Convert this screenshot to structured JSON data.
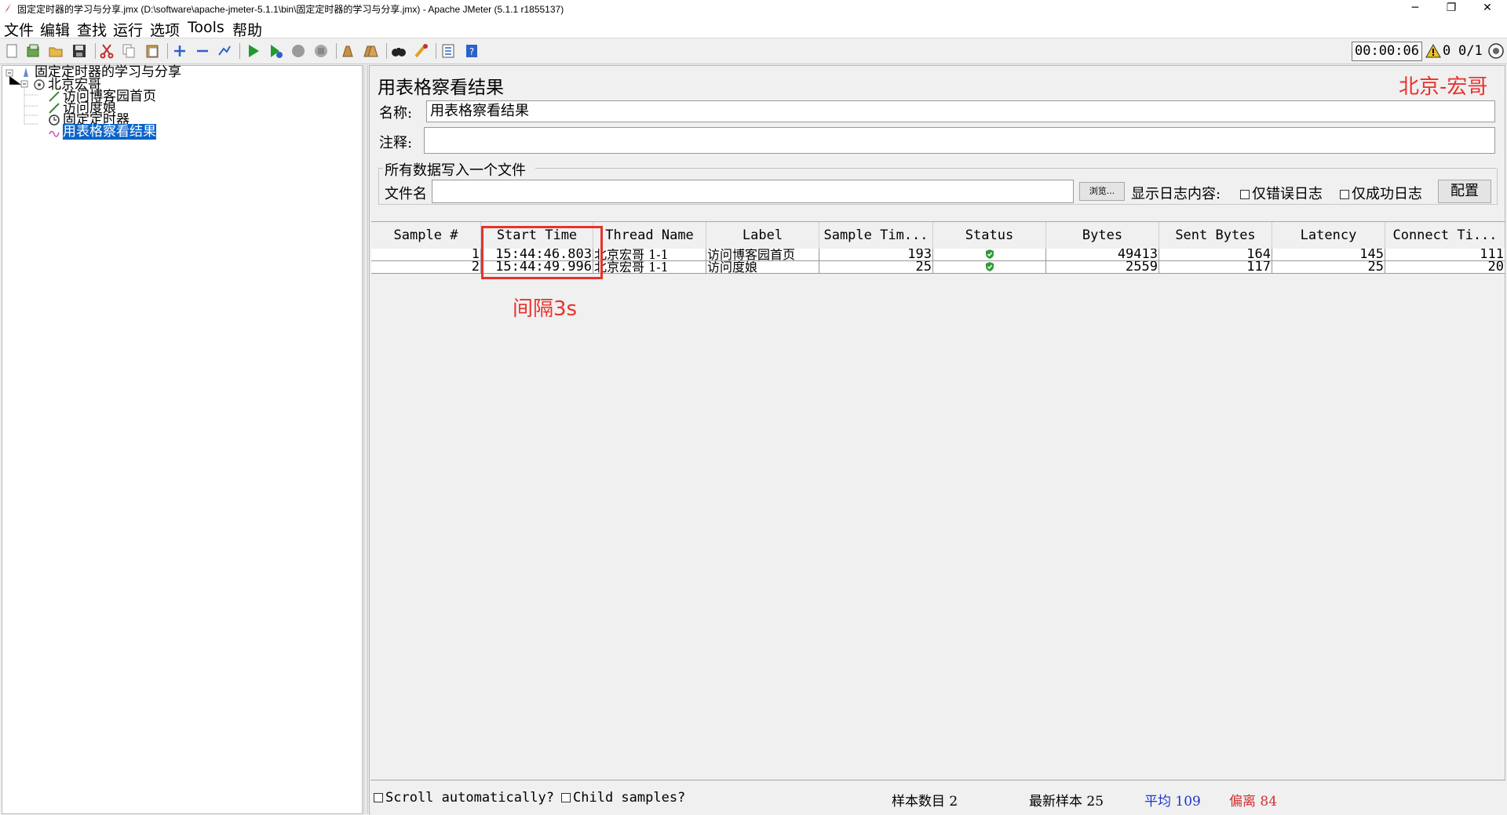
{
  "window": {
    "title": "固定定时器的学习与分享.jmx (D:\\software\\apache-jmeter-5.1.1\\bin\\固定定时器的学习与分享.jmx) - Apache JMeter (5.1.1 r1855137)",
    "minimize": "─",
    "restore": "❐",
    "close": "✕"
  },
  "menu": [
    "文件",
    "编辑",
    "查找",
    "运行",
    "选项",
    "Tools",
    "帮助"
  ],
  "toolbar": {
    "icons": [
      "new-icon",
      "templates-icon",
      "open-icon",
      "save-icon",
      "cut-icon",
      "copy-icon",
      "paste-icon",
      "expand-icon",
      "collapse-icon",
      "toggle-icon",
      "start-icon",
      "start-no-pause-icon",
      "stop-icon",
      "shutdown-icon",
      "clear-icon",
      "clear-all-icon",
      "search-icon",
      "reset-search-icon",
      "function-helper-icon",
      "help-icon"
    ],
    "timer": "00:00:06",
    "warning_count": "0",
    "threads": "0/1"
  },
  "tree": {
    "items": [
      {
        "label": "固定定时器的学习与分享",
        "icon": "test-plan-icon"
      },
      {
        "label": "北京宏哥",
        "icon": "thread-group-icon"
      },
      {
        "label": "访问博客园首页",
        "icon": "http-sampler-icon"
      },
      {
        "label": "访问度娘",
        "icon": "http-sampler-icon"
      },
      {
        "label": "固定定时器",
        "icon": "timer-icon"
      },
      {
        "label": "用表格察看结果",
        "icon": "listener-icon",
        "selected": true
      }
    ]
  },
  "panel": {
    "title": "用表格察看结果",
    "watermark": "北京-宏哥",
    "name_label": "名称:",
    "name_value": "用表格察看结果",
    "comment_label": "注释:",
    "comment_value": "",
    "file_group_label": "所有数据写入一个文件",
    "filename_label": "文件名",
    "filename_value": "",
    "browse_label": "浏览...",
    "log_label": "显示日志内容:",
    "errors_only_label": "仅错误日志",
    "success_only_label": "仅成功日志",
    "configure_label": "配置"
  },
  "table": {
    "columns": [
      "Sample #",
      "Start Time",
      "Thread Name",
      "Label",
      "Sample Tim...",
      "Status",
      "Bytes",
      "Sent Bytes",
      "Latency",
      "Connect Ti..."
    ],
    "rows": [
      {
        "sample": "1",
        "start": "15:44:46.803",
        "thread": "北京宏哥 1-1",
        "label": "访问博客园首页",
        "time": "193",
        "status": "success",
        "bytes": "49413",
        "sent": "164",
        "latency": "145",
        "connect": "111"
      },
      {
        "sample": "2",
        "start": "15:44:49.996",
        "thread": "北京宏哥 1-1",
        "label": "访问度娘",
        "time": "25",
        "status": "success",
        "bytes": "2559",
        "sent": "117",
        "latency": "25",
        "connect": "20"
      }
    ],
    "status_success_color": "#2e9a36"
  },
  "annotation": {
    "text": "间隔3s",
    "color": "#e8322c"
  },
  "statusbar": {
    "scroll_label": "Scroll automatically?",
    "child_label": "Child samples?",
    "sample_count": "样本数目 2",
    "latest_sample": "最新样本 25",
    "average": "平均 109",
    "deviation": "偏离 84",
    "average_color": "#1c36c8",
    "deviation_color": "#d03030"
  }
}
